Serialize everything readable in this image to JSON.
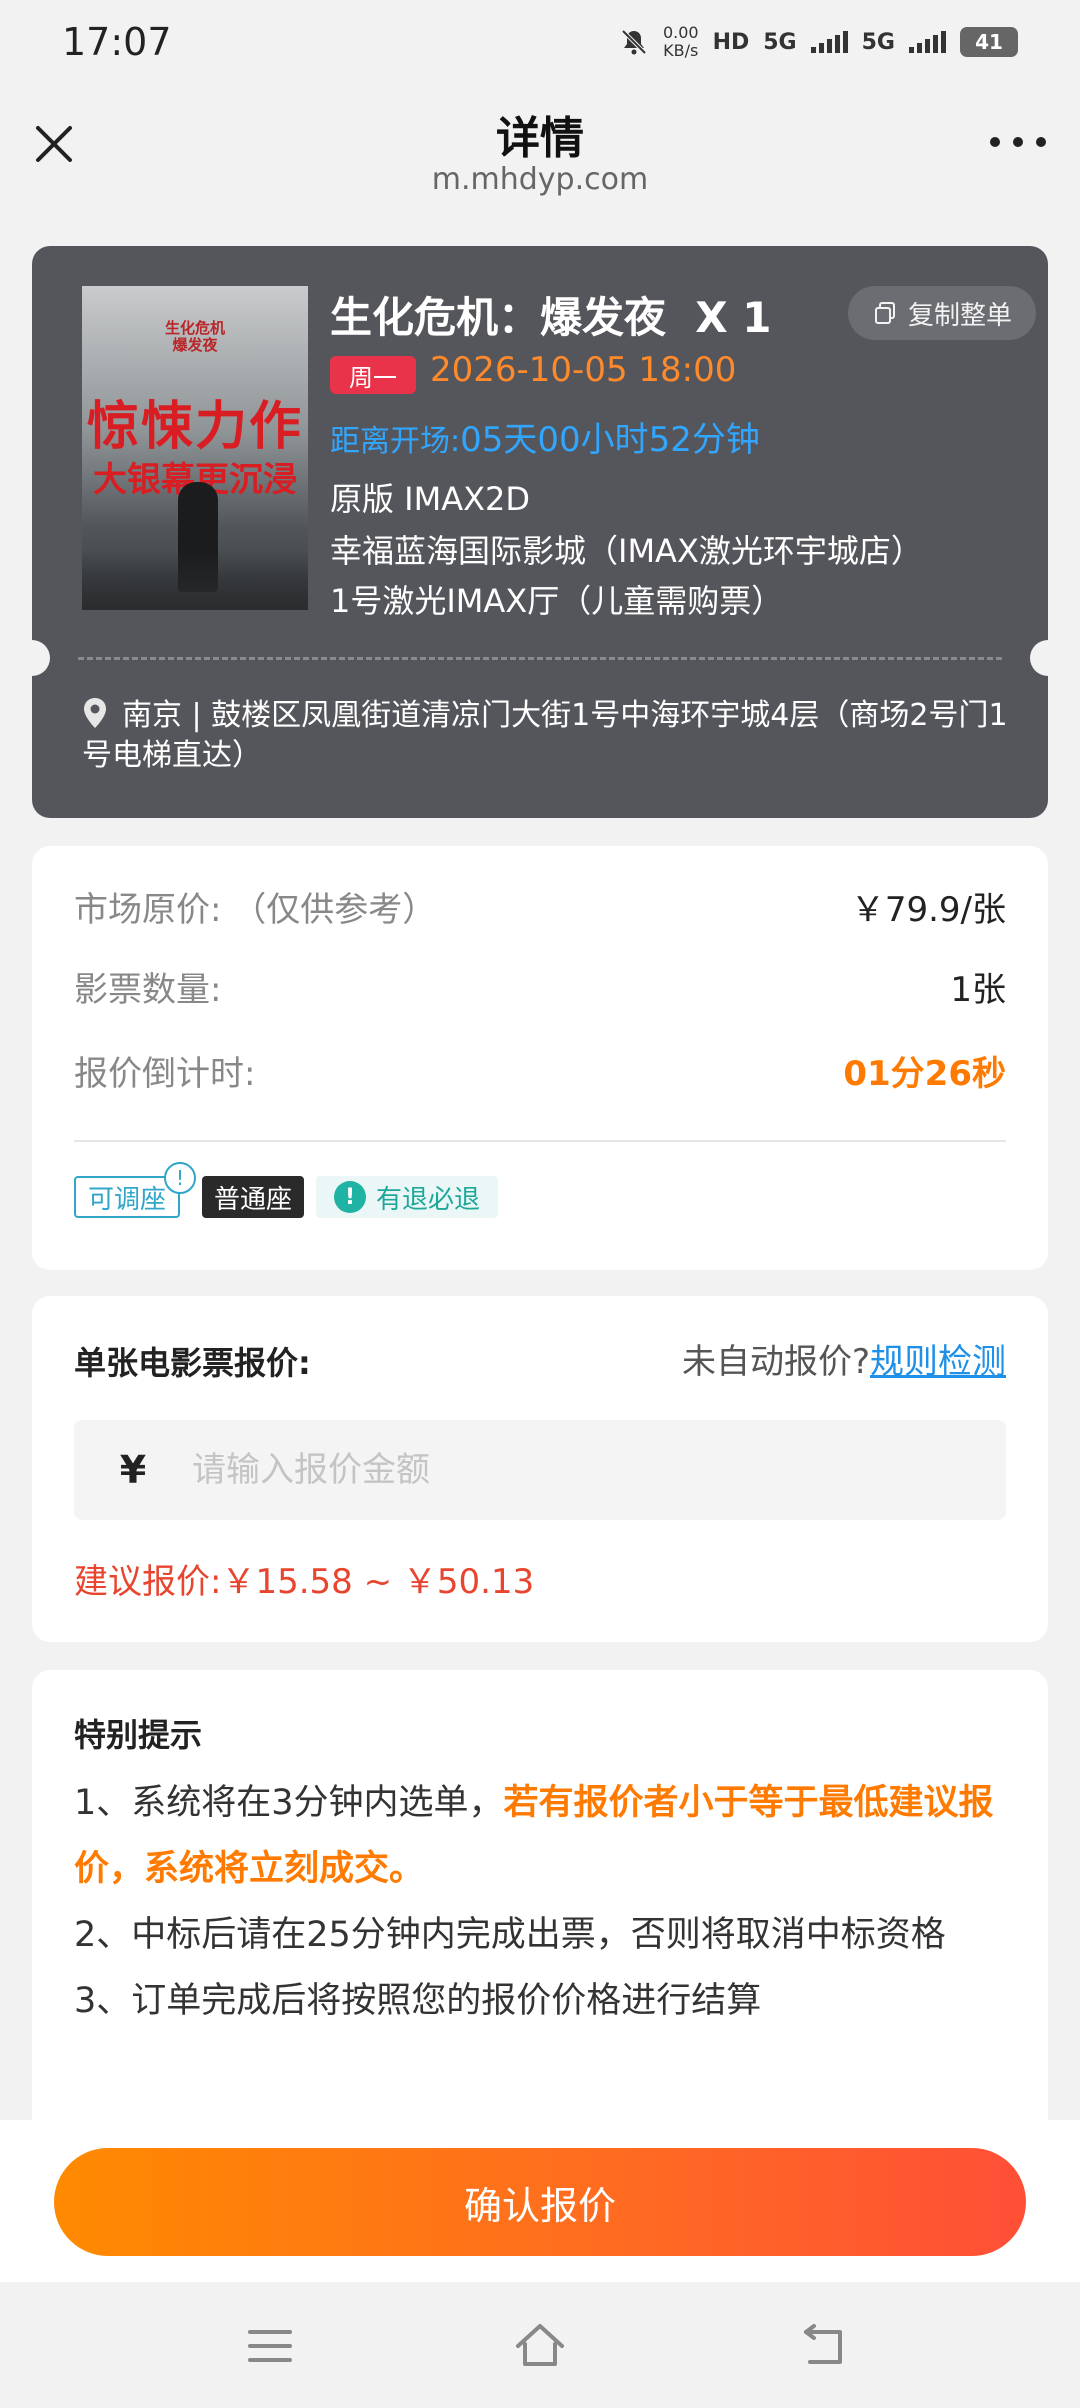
{
  "status_bar": {
    "time": "17:07",
    "net_speed": "0.00",
    "net_unit": "KB/s",
    "hd": "HD",
    "sim1": "5G",
    "sim2": "5G",
    "battery": "41"
  },
  "nav": {
    "title": "详情",
    "url": "m.mhdyp.com"
  },
  "ticket": {
    "poster": {
      "top_text": "生化危机\n爆发夜",
      "main_text": "惊悚力作",
      "sub_text": "大银幕更沉浸"
    },
    "copy_button": "复制整单",
    "movie_title": "生化危机：爆发夜  X 1",
    "weekday": "周一",
    "showtime": "2026-10-05 18:00",
    "countdown_label": "距离开场:",
    "countdown_value": "05天00小时52分钟",
    "edition": "原版 IMAX2D",
    "cinema": "幸福蓝海国际影城（IMAX激光环宇城店）",
    "hall": "1号激光IMAX厅（儿童需购票）",
    "address": "南京 | 鼓楼区凤凰街道清凉门大街1号中海环宇城4层（商场2号门1号电梯直达）"
  },
  "info": {
    "rows": [
      {
        "label": "市场原价: （仅供参考）",
        "value": "￥79.9/张"
      },
      {
        "label": "影票数量:",
        "value": "1张"
      },
      {
        "label": "报价倒计时:",
        "value": "01分26秒"
      }
    ],
    "tags": {
      "adjust": "可调座",
      "adjust_bubble": "!",
      "normal": "普通座",
      "refund": "有退必退",
      "refund_icon": "!"
    }
  },
  "quote": {
    "label": "单张电影票报价:",
    "question": "未自动报价?",
    "rule_link": "规则检测",
    "currency": "¥",
    "placeholder": "请输入报价金额",
    "suggestion": "建议报价:￥15.58 ~ ￥50.13"
  },
  "tips": {
    "title": "特别提示",
    "line1_normal": "1、系统将在3分钟内选单，",
    "line1_highlight": "若有报价者小于等于最低建议报价，系统将立刻成交。",
    "line2": "2、中标后请在25分钟内完成出票，否则将取消中标资格",
    "line3": "3、订单完成后将按照您的报价价格进行结算"
  },
  "actions": {
    "confirm": "确认报价"
  },
  "colors": {
    "accent_orange": "#ff7a00",
    "countdown_blue": "#31a6ff",
    "weekday_red": "#e8334a",
    "ticket_bg": "#55565b"
  }
}
